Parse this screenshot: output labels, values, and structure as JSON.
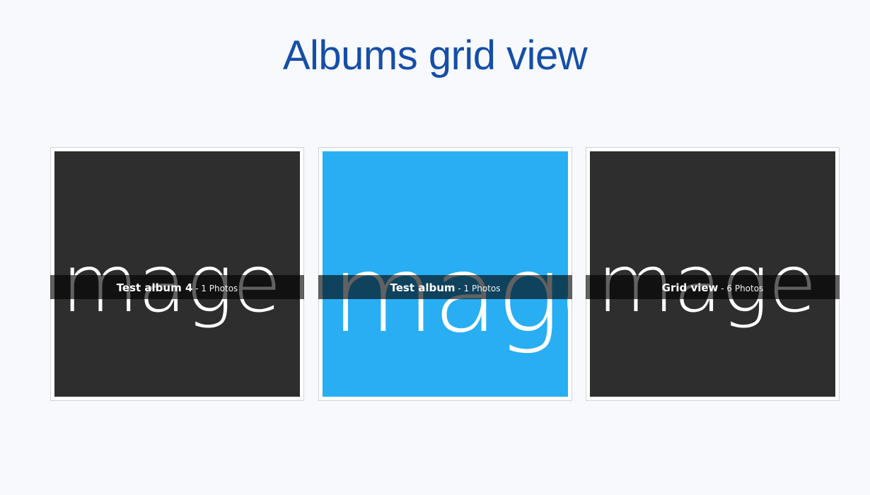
{
  "page": {
    "title": "Albums grid view",
    "title_color": "#164ea8",
    "background": "#f7f9fc"
  },
  "albums": [
    {
      "name": "Test album 4",
      "separator": " - ",
      "count": "1 Photos",
      "thumb_text": "Image three",
      "thumb_color": "#2e2e2e"
    },
    {
      "name": "Test album",
      "separator": " - ",
      "count": "1 Photos",
      "thumb_text": "Image",
      "thumb_color": "#29aef3"
    },
    {
      "name": "Grid view",
      "separator": " - ",
      "count": "6 Photos",
      "thumb_text": "Image three",
      "thumb_color": "#2e2e2e"
    }
  ]
}
